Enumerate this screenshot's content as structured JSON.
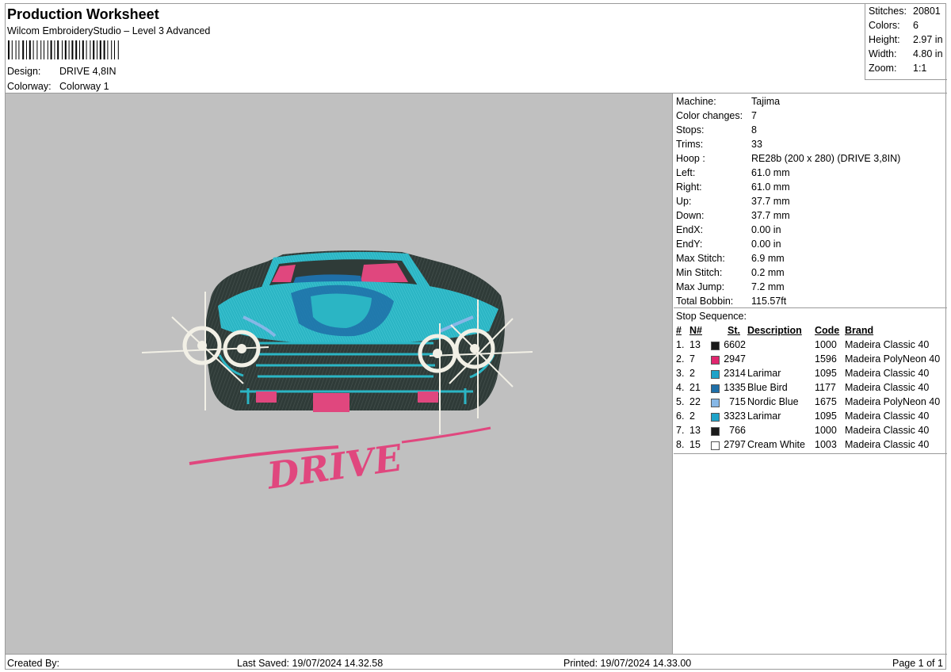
{
  "header": {
    "title": "Production Worksheet",
    "subtitle": "Wilcom EmbroideryStudio – Level 3 Advanced",
    "design_label": "Design:",
    "design_value": "DRIVE 4,8IN",
    "colorway_label": "Colorway:",
    "colorway_value": "Colorway 1"
  },
  "stats": [
    {
      "label": "Stitches:",
      "value": "20801"
    },
    {
      "label": "Colors:",
      "value": "6"
    },
    {
      "label": "Height:",
      "value": "2.97 in"
    },
    {
      "label": "Width:",
      "value": "4.80 in"
    },
    {
      "label": "Zoom:",
      "value": "1:1"
    }
  ],
  "info": [
    {
      "label": "Machine:",
      "value": "Tajima"
    },
    {
      "label": "Color changes:",
      "value": "7"
    },
    {
      "label": "Stops:",
      "value": "8"
    },
    {
      "label": "Trims:",
      "value": "33"
    },
    {
      "label": "Hoop :",
      "value": "RE28b (200 x 280) (DRIVE 3,8IN)"
    },
    {
      "label": "Left:",
      "value": "61.0 mm"
    },
    {
      "label": "Right:",
      "value": "61.0 mm"
    },
    {
      "label": "Up:",
      "value": "37.7 mm"
    },
    {
      "label": "Down:",
      "value": "37.7 mm"
    },
    {
      "label": "EndX:",
      "value": "0.00 in"
    },
    {
      "label": "EndY:",
      "value": "0.00 in"
    },
    {
      "label": "Max Stitch:",
      "value": "6.9 mm"
    },
    {
      "label": "Min Stitch:",
      "value": "0.2 mm"
    },
    {
      "label": "Max Jump:",
      "value": "7.2 mm"
    },
    {
      "label": "Total Bobbin:",
      "value": "115.57ft"
    }
  ],
  "sequence": {
    "title": "Stop Sequence:",
    "columns": {
      "num": "#",
      "n": "N#",
      "st": "St.",
      "desc": "Description",
      "code": "Code",
      "brand": "Brand"
    },
    "rows": [
      {
        "num": "1.",
        "n": "13",
        "color": "#1a1a1a",
        "st": "6602",
        "desc": "",
        "code": "1000",
        "brand": "Madeira Classic 40"
      },
      {
        "num": "2.",
        "n": "7",
        "color": "#e0266e",
        "st": "2947",
        "desc": "",
        "code": "1596",
        "brand": "Madeira PolyNeon 40"
      },
      {
        "num": "3.",
        "n": "2",
        "color": "#1fa3c9",
        "st": "2314",
        "desc": "Larimar",
        "code": "1095",
        "brand": "Madeira Classic 40"
      },
      {
        "num": "4.",
        "n": "21",
        "color": "#1f6fa8",
        "st": "1335",
        "desc": "Blue Bird",
        "code": "1177",
        "brand": "Madeira Classic 40"
      },
      {
        "num": "5.",
        "n": "22",
        "color": "#86b7e6",
        "st": "715",
        "desc": "Nordic Blue",
        "code": "1675",
        "brand": "Madeira PolyNeon 40"
      },
      {
        "num": "6.",
        "n": "2",
        "color": "#1fa3c9",
        "st": "3323",
        "desc": "Larimar",
        "code": "1095",
        "brand": "Madeira Classic 40"
      },
      {
        "num": "7.",
        "n": "13",
        "color": "#1a1a1a",
        "st": "766",
        "desc": "",
        "code": "1000",
        "brand": "Madeira Classic 40"
      },
      {
        "num": "8.",
        "n": "15",
        "color": "#ffffff",
        "st": "2797",
        "desc": "Cream White",
        "code": "1003",
        "brand": "Madeira Classic 40"
      }
    ]
  },
  "design_text": "DRIVE",
  "colors": {
    "teal": "#2bb5c4",
    "dark": "#2f3b38",
    "pink": "#e0477e",
    "cream": "#f2f0e6",
    "canvas": "#c0c0c0"
  },
  "footer": {
    "created_by": "Created By:",
    "last_saved": "Last Saved: 19/07/2024 14.32.58",
    "printed": "Printed: 19/07/2024 14.33.00",
    "page": "Page 1 of 1"
  }
}
